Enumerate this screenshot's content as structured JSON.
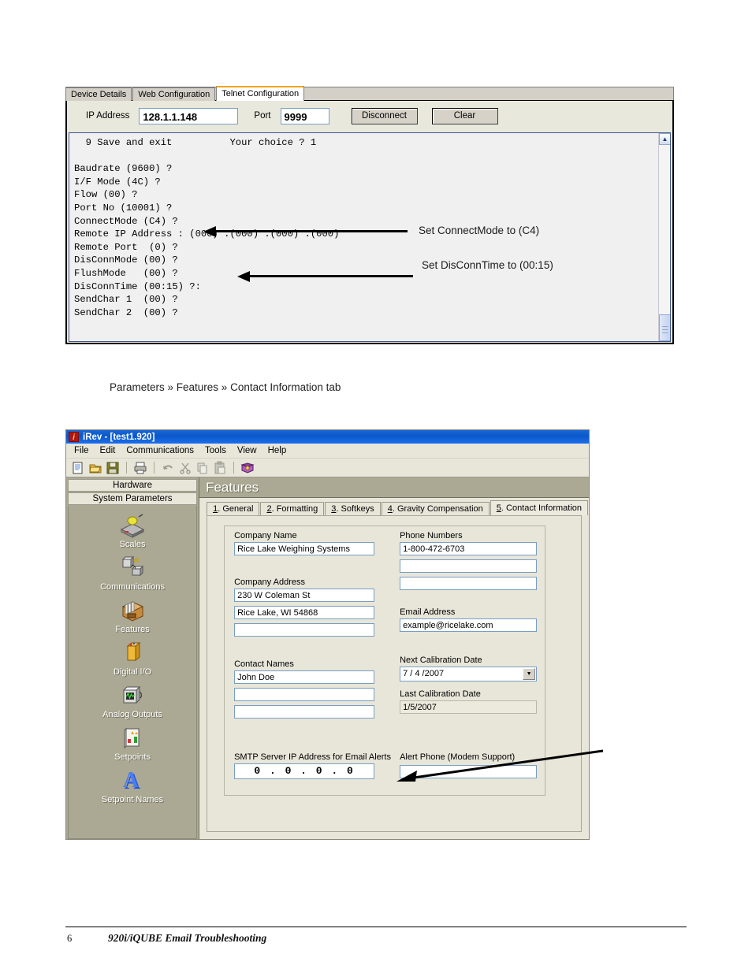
{
  "telnet": {
    "tabs": [
      {
        "label": "Device Details",
        "active": false
      },
      {
        "label": "Web Configuration",
        "active": false
      },
      {
        "label": "Telnet Configuration",
        "active": true
      }
    ],
    "ip_label": "IP Address",
    "ip_value": "128.1.1.148",
    "port_label": "Port",
    "port_value": "9999",
    "disconnect_label": "Disconnect",
    "clear_label": "Clear",
    "console_text": "  9 Save and exit          Your choice ? 1\n\nBaudrate (9600) ?\nI/F Mode (4C) ?\nFlow (00) ?\nPort No (10001) ?\nConnectMode (C4) ?\nRemote IP Address : (000) .(000) .(000) .(000)\nRemote Port  (0) ?\nDisConnMode (00) ?\nFlushMode   (00) ?\nDisConnTime (00:15) ?:\nSendChar 1  (00) ?\nSendChar 2  (00) ?",
    "scroll_up_glyph": "▲"
  },
  "annotations": {
    "connect_mode": "Set ConnectMode to (C4)",
    "disconn_time": "Set DisConnTime to (00:15)"
  },
  "caption": "Parameters » Features » Contact Information tab",
  "irev": {
    "title": "iRev - [test1.920]",
    "title_icon_char": "i",
    "menus": [
      "File",
      "Edit",
      "Communications",
      "Tools",
      "View",
      "Help"
    ],
    "toolbar_icons": [
      "new-document-icon",
      "open-folder-icon",
      "save-disk-icon",
      "print-icon",
      "undo-icon",
      "cut-scissors-icon",
      "copy-icon",
      "paste-icon",
      "help-book-icon"
    ],
    "sidebar": {
      "header_top": "Hardware",
      "header_sub": "System Parameters",
      "items": [
        {
          "label": "Scales",
          "icon": "scale-icon"
        },
        {
          "label": "Communications",
          "icon": "communications-icon"
        },
        {
          "label": "Features",
          "icon": "features-box-icon"
        },
        {
          "label": "Digital I/O",
          "icon": "digital-io-icon"
        },
        {
          "label": "Analog Outputs",
          "icon": "analog-output-icon"
        },
        {
          "label": "Setpoints",
          "icon": "setpoints-icon"
        },
        {
          "label": "Setpoint Names",
          "icon": "setpoint-names-icon"
        }
      ]
    },
    "content_title": "Features",
    "tabs": [
      {
        "num": "1",
        "label": ". General",
        "active": false
      },
      {
        "num": "2",
        "label": ". Formatting",
        "active": false
      },
      {
        "num": "3",
        "label": ". Softkeys",
        "active": false
      },
      {
        "num": "4",
        "label": ". Gravity Compensation",
        "active": false
      },
      {
        "num": "5",
        "label": ". Contact Information",
        "active": true
      }
    ],
    "form": {
      "company_name_label": "Company Name",
      "company_name_value": "Rice Lake Weighing Systems",
      "company_address_label": "Company Address",
      "company_address_1": "230 W Coleman St",
      "company_address_2": "Rice Lake, WI  54868",
      "company_address_3": "",
      "contact_names_label": "Contact Names",
      "contact_name_1": "John Doe",
      "contact_name_2": "",
      "contact_name_3": "",
      "phone_numbers_label": "Phone Numbers",
      "phone_1": "1-800-472-6703",
      "phone_2": "",
      "phone_3": "",
      "email_label": "Email Address",
      "email_value": "example@ricelake.com",
      "next_cal_label": "Next Calibration Date",
      "next_cal_value": "7 / 4 /2007",
      "last_cal_label": "Last Calibration Date",
      "last_cal_value": "1/5/2007",
      "smtp_label": "SMTP Server IP Address for Email Alerts",
      "smtp_value": "0  .  0  .  0  .  0",
      "alert_phone_label": "Alert Phone (Modem Support)",
      "alert_phone_value": ""
    }
  },
  "footer": {
    "page": "6",
    "title": "920i/iQUBE Email Troubleshooting"
  }
}
